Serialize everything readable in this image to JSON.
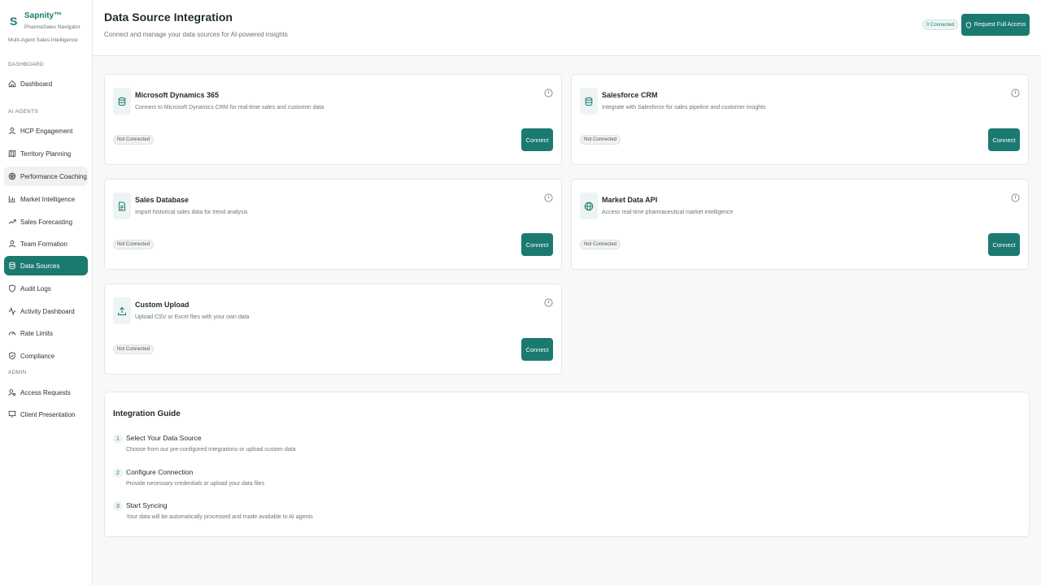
{
  "brand": {
    "logo": "S",
    "name": "Sapnity™",
    "subtitle": "PharmaSales Navigator",
    "tagline": "Multi-Agent Sales Intelligence"
  },
  "sidebar": {
    "section_dashboard": "DASHBOARD",
    "section_ai_agents": "AI AGENTS",
    "section_admin": "ADMIN",
    "items": [
      {
        "label": "Dashboard",
        "icon": "home-icon"
      },
      {
        "label": "HCP Engagement",
        "icon": "user-icon"
      },
      {
        "label": "Territory Planning",
        "icon": "map-icon"
      },
      {
        "label": "Performance Coaching",
        "icon": "target-icon"
      },
      {
        "label": "Market Intelligence",
        "icon": "bar-chart-icon"
      },
      {
        "label": "Sales Forecasting",
        "icon": "trending-up-icon"
      },
      {
        "label": "Team Formation",
        "icon": "user-icon"
      },
      {
        "label": "Data Sources",
        "icon": "database-icon"
      },
      {
        "label": "Audit Logs",
        "icon": "shield-icon"
      },
      {
        "label": "Activity Dashboard",
        "icon": "activity-icon"
      },
      {
        "label": "Rate Limits",
        "icon": "gauge-icon"
      },
      {
        "label": "Compliance",
        "icon": "shield-check-icon"
      },
      {
        "label": "Access Requests",
        "icon": "user-key-icon"
      },
      {
        "label": "Client Presentation",
        "icon": "presentation-icon"
      }
    ]
  },
  "header": {
    "title": "Data Source Integration",
    "subtitle": "Connect and manage your data sources for AI-powered insights",
    "connected_badge": "0 Connected",
    "request_button": "Request Full Access"
  },
  "cards": [
    {
      "title": "Microsoft Dynamics 365",
      "desc": "Connect to Microsoft Dynamics CRM for real-time sales and customer data",
      "status": "Not Connected",
      "button": "Connect",
      "icon": "database-icon"
    },
    {
      "title": "Salesforce CRM",
      "desc": "Integrate with Salesforce for sales pipeline and customer insights",
      "status": "Not Connected",
      "button": "Connect",
      "icon": "database-icon"
    },
    {
      "title": "Sales Database",
      "desc": "Import historical sales data for trend analysis",
      "status": "Not Connected",
      "button": "Connect",
      "icon": "file-text-icon"
    },
    {
      "title": "Market Data API",
      "desc": "Access real-time pharmaceutical market intelligence",
      "status": "Not Connected",
      "button": "Connect",
      "icon": "globe-icon"
    },
    {
      "title": "Custom Upload",
      "desc": "Upload CSV or Excel files with your own data",
      "status": "Not Connected",
      "button": "Connect",
      "icon": "upload-icon"
    }
  ],
  "guide": {
    "title": "Integration Guide",
    "steps": [
      {
        "num": "1",
        "title": "Select Your Data Source",
        "desc": "Choose from our pre-configured integrations or upload custom data"
      },
      {
        "num": "2",
        "title": "Configure Connection",
        "desc": "Provide necessary credentials or upload your data files"
      },
      {
        "num": "3",
        "title": "Start Syncing",
        "desc": "Your data will be automatically processed and made available to AI agents"
      }
    ]
  },
  "colors": {
    "accent": "#1a7a70",
    "background": "#f7f8f8",
    "card": "#ffffff"
  }
}
